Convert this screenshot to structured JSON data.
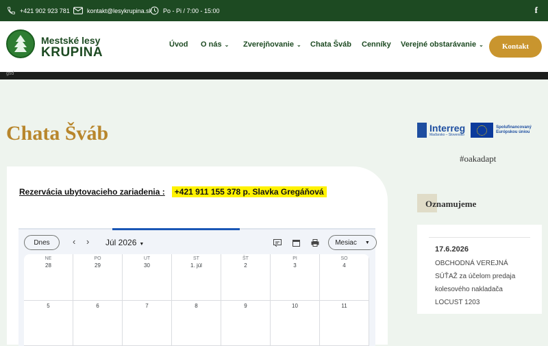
{
  "topbar": {
    "phone": "+421 902 923 781",
    "email": "kontakt@lesykrupina.sk",
    "hours": "Po - Pi / 7:00 - 15:00",
    "social_icon": "facebook-icon",
    "social_glyph": "f"
  },
  "logo": {
    "line1": "Mestské lesy",
    "line2": "KRUPINA"
  },
  "nav": {
    "items": [
      {
        "label": "Úvod"
      },
      {
        "label": "O nás"
      },
      {
        "label": "Zverejňovanie"
      },
      {
        "label": "Chata Šváb"
      },
      {
        "label": "Cenníky"
      },
      {
        "label": "Verejné obstarávanie"
      }
    ],
    "cta": "Kontakt"
  },
  "darkbar": {
    "text": "gsd"
  },
  "page": {
    "title": "Chata Šváb"
  },
  "reservation": {
    "label": "Rezervácia ubytovacieho zariadenia :",
    "contact": "+421 911 155 378 p. Slavka Gregáňová"
  },
  "calendar": {
    "today_label": "Dnes",
    "prev_glyph": "‹",
    "next_glyph": "›",
    "month": "Júl 2026",
    "view_label": "Mesiac",
    "weekdays": [
      "NE",
      "PO",
      "UT",
      "ST",
      "ŠT",
      "PI",
      "SO"
    ],
    "week1": [
      "28",
      "29",
      "30",
      "1. júl",
      "2",
      "3",
      "4"
    ],
    "week2": [
      "5",
      "6",
      "7",
      "8",
      "9",
      "10",
      "11"
    ]
  },
  "sidebar": {
    "interreg_name": "Interreg",
    "interreg_sub": "Maďarsko – Slovensko",
    "eu_line1": "Spolufinancovaný",
    "eu_line2": "Európskou úniou",
    "hashtag": "#oakadapt",
    "section_title": "Oznamujeme",
    "news_date": "17.6.2026",
    "news_text": "OBCHODNÁ VEREJNÁ SÚŤAŽ za účelom predaja kolesového nakladača LOCUST 1203"
  },
  "colors": {
    "green": "#1d4a22",
    "gold": "#b8862c",
    "cta": "#c9952e",
    "highlight": "#fff200"
  }
}
